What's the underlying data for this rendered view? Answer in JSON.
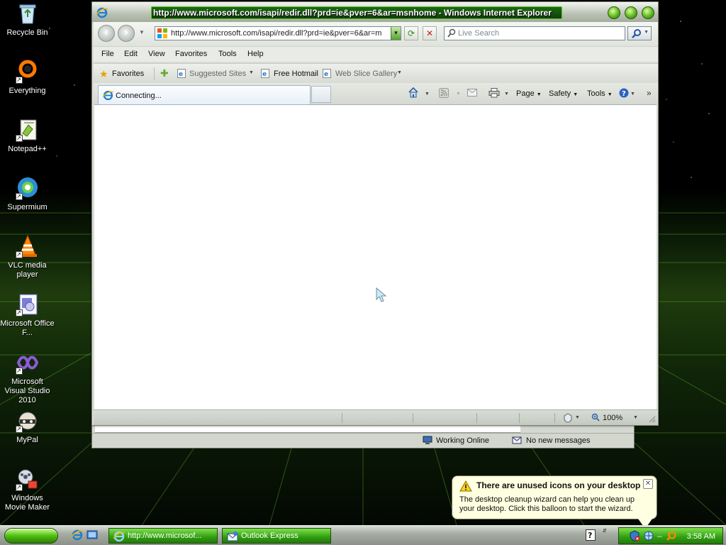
{
  "desktop": {
    "icons": [
      {
        "label": "Recycle Bin",
        "icon": "recycle-bin-icon"
      },
      {
        "label": "Everything",
        "icon": "everything-search-icon"
      },
      {
        "label": "Notepad++",
        "icon": "notepad-plus-plus-icon"
      },
      {
        "label": "Supermium",
        "icon": "supermium-browser-icon"
      },
      {
        "label": "VLC media player",
        "icon": "vlc-cone-icon"
      },
      {
        "label": "Microsoft Office F...",
        "icon": "office-document-icon"
      },
      {
        "label": "Microsoft Visual Studio 2010",
        "icon": "visual-studio-icon"
      },
      {
        "label": "MyPal",
        "icon": "mypal-raccoon-icon"
      },
      {
        "label": "Windows Movie Maker",
        "icon": "movie-maker-icon"
      }
    ]
  },
  "ie": {
    "title": "http://www.microsoft.com/isapi/redir.dll?prd=ie&pver=6&ar=msnhome - Windows Internet Explorer",
    "address": "http://www.microsoft.com/isapi/redir.dll?prd=ie&pver=6&ar=m",
    "search_placeholder": "Live Search",
    "menu": [
      "File",
      "Edit",
      "View",
      "Favorites",
      "Tools",
      "Help"
    ],
    "favorites_label": "Favorites",
    "fav_links": [
      "Suggested Sites",
      "Free Hotmail",
      "Web Slice Gallery"
    ],
    "tab_label": "Connecting...",
    "commands": [
      "Page",
      "Safety",
      "Tools"
    ],
    "zoom": "100%"
  },
  "outlook": {
    "status_online": "Working Online",
    "status_messages": "No new messages"
  },
  "balloon": {
    "title": "There are unused icons on your desktop",
    "body": "The desktop cleanup wizard can help you clean up your desktop. Click this balloon to start the wizard."
  },
  "taskbar": {
    "tasks": [
      "http://www.microsof...",
      "Outlook Express"
    ],
    "clock": "3:58 AM"
  },
  "colors": {
    "accent_green": "#2f9d10",
    "balloon_bg": "#ffffe1"
  }
}
